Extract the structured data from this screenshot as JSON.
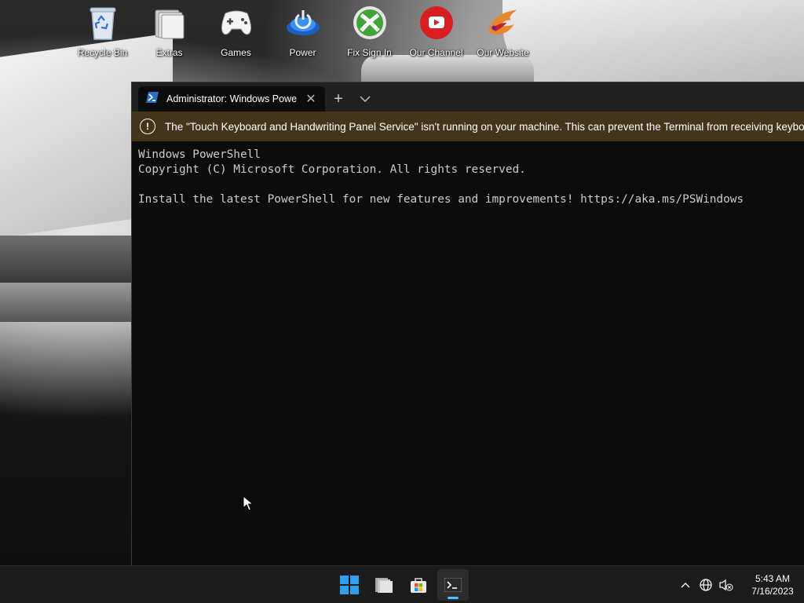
{
  "desktop": {
    "icons": [
      {
        "label": "Recycle Bin",
        "icon": "recycle-bin-icon"
      },
      {
        "label": "Extras",
        "icon": "folder-icon"
      },
      {
        "label": "Games",
        "icon": "gamepad-icon"
      },
      {
        "label": "Power",
        "icon": "power-icon"
      },
      {
        "label": "Fix Sign In",
        "icon": "xbox-icon"
      },
      {
        "label": "Our Channel",
        "icon": "youtube-icon"
      },
      {
        "label": "Our Website",
        "icon": "phoenix-icon"
      }
    ]
  },
  "terminal": {
    "tab_title": "Administrator: Windows PowerShell",
    "new_tab_symbol": "+",
    "warning": "The \"Touch Keyboard and Handwriting Panel Service\" isn't running on your machine. This can prevent the Terminal from receiving keyboard input.",
    "console_lines": [
      "Windows PowerShell",
      "Copyright (C) Microsoft Corporation. All rights reserved.",
      "",
      "Install the latest PowerShell for new features and improvements! https://aka.ms/PSWindows"
    ]
  },
  "taskbar": {
    "apps": [
      "start-icon",
      "file-explorer-icon",
      "store-icon",
      "terminal-icon"
    ],
    "clock_time": "5:43 AM",
    "clock_date": "7/16/2023"
  },
  "colors": {
    "accent": "#4cc2ff",
    "warning_bar": "#433519",
    "console_bg": "#0c0c0c"
  }
}
